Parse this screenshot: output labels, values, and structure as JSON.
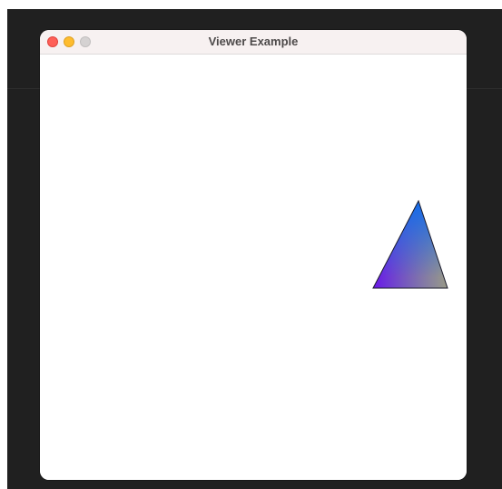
{
  "window": {
    "title": "Viewer Example"
  },
  "traffic_lights": {
    "close_color": "#fe5f57",
    "minimize_color": "#febc2e",
    "zoom_color": "#d5d2d2"
  },
  "scene": {
    "shape": "triangle",
    "vertex_colors": [
      "#0a6cf0",
      "#6a06f2",
      "#a0a080"
    ]
  }
}
